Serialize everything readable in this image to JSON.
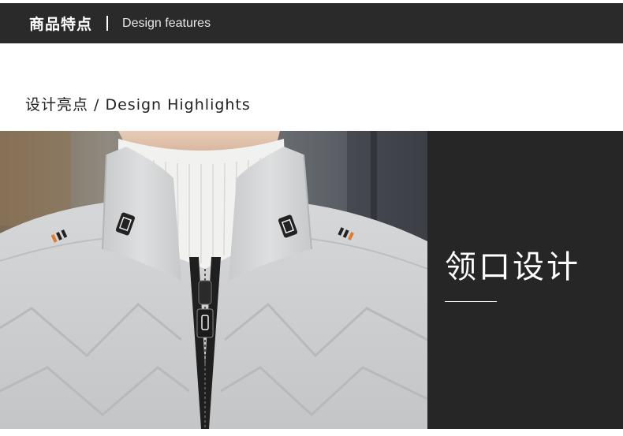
{
  "header": {
    "title_cn": "商品特点",
    "title_en": "Design features"
  },
  "section": {
    "subtitle": "设计亮点 / Design Highlights"
  },
  "feature": {
    "title": "领口设计"
  },
  "colors": {
    "header_bg": "#2a2a2a",
    "panel_bg": "#262626",
    "jacket": "#cfd0d1",
    "sweater": "#f1f1ef"
  }
}
